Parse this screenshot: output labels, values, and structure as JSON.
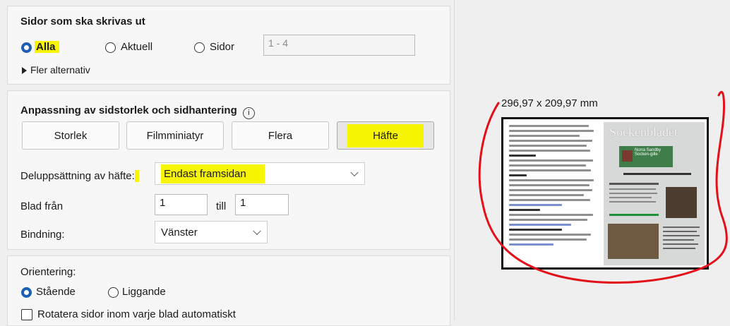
{
  "pages": {
    "title": "Sidor som ska skrivas ut",
    "options": [
      "Alla",
      "Aktuell",
      "Sidor"
    ],
    "range_value": "1 - 4",
    "more": "Fler alternativ"
  },
  "fit": {
    "title": "Anpassning av sidstorlek och sidhantering",
    "info": "i",
    "buttons": [
      "Storlek",
      "Filmminiatyr",
      "Flera",
      "Häfte"
    ],
    "subset_label": "Deluppsättning av häfte:",
    "subset_value": "Endast framsidan",
    "from_label": "Blad från",
    "from_value": "1",
    "to_label": "till",
    "to_value": "1",
    "binding_label": "Bindning:",
    "binding_value": "Vänster"
  },
  "orientation": {
    "title": "Orientering:",
    "options": [
      "Stående",
      "Liggande"
    ],
    "rotate": "Rotatera sidor inom varje blad automatiskt"
  },
  "preview": {
    "size": "296,97 x 209,97 mm",
    "masthead": "Sockenbladet",
    "logo_text": "Norra Sandby Socken-gille"
  },
  "colors": {
    "highlight": "#f7f500",
    "annotation": "#e3101a",
    "radio_selected": "#1a5fb4"
  }
}
